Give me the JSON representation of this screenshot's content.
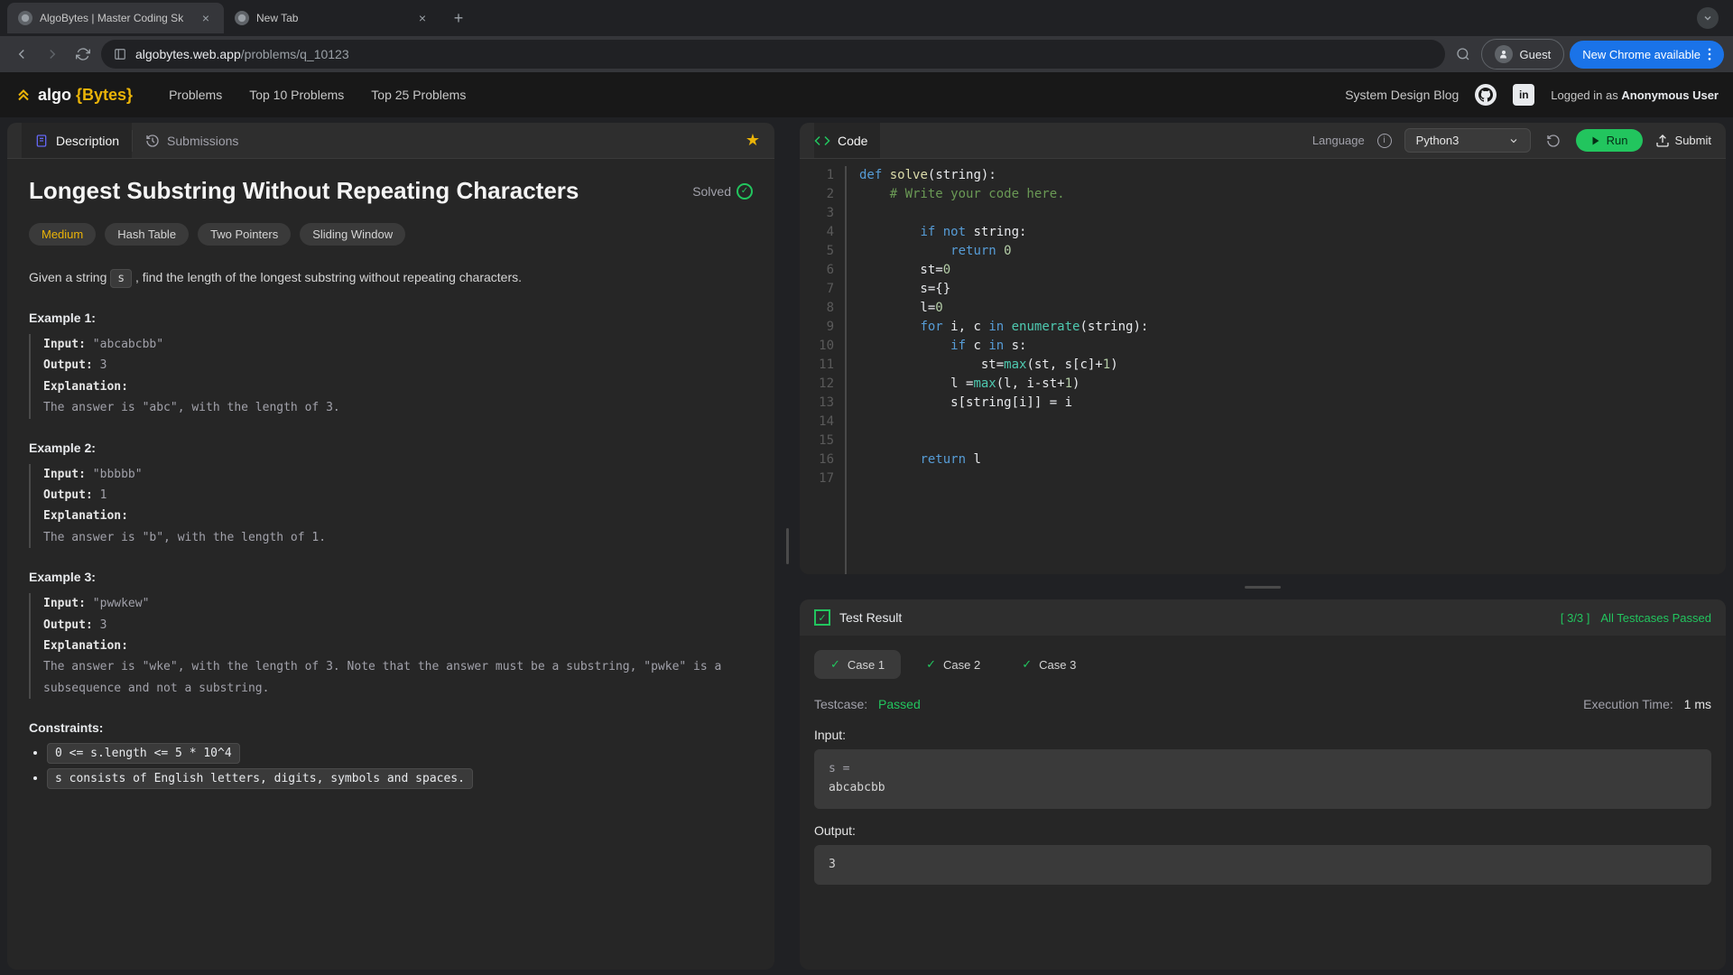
{
  "browser": {
    "tabs": [
      {
        "title": "AlgoBytes | Master Coding Sk",
        "active": true
      },
      {
        "title": "New Tab",
        "active": false
      }
    ],
    "url_domain": "algobytes.web.app",
    "url_path": "/problems/q_10123",
    "guest": "Guest",
    "new_chrome": "New Chrome available"
  },
  "header": {
    "logo_prefix": "algo",
    "logo_suffix": "{Bytes}",
    "nav": [
      "Problems",
      "Top 10 Problems",
      "Top 25 Problems"
    ],
    "right_link": "System Design Blog",
    "logged_in_prefix": "Logged in as ",
    "logged_in_user": "Anonymous User"
  },
  "left_panel": {
    "tabs": [
      "Description",
      "Submissions"
    ],
    "title": "Longest Substring Without Repeating Characters",
    "solved": "Solved",
    "tags": [
      "Medium",
      "Hash Table",
      "Two Pointers",
      "Sliding Window"
    ],
    "description_pre": "Given a string ",
    "description_var": "s",
    "description_post": " , find the length of the longest substring without repeating characters.",
    "examples": [
      {
        "title": "Example 1:",
        "input": "\"abcabcbb\"",
        "output": "3",
        "explanation": "The answer is \"abc\", with the length of 3."
      },
      {
        "title": "Example 2:",
        "input": "\"bbbbb\"",
        "output": "1",
        "explanation": "The answer is \"b\", with the length of 1."
      },
      {
        "title": "Example 3:",
        "input": "\"pwwkew\"",
        "output": "3",
        "explanation": "The answer is \"wke\", with the length of 3. Note that the answer must be a substring, \"pwke\" is a subsequence and not a substring."
      }
    ],
    "labels": {
      "input": "Input:",
      "output": "Output:",
      "explanation": "Explanation:"
    },
    "constraints_title": "Constraints:",
    "constraints": [
      "0 <= s.length <= 5 * 10^4",
      "s consists of English letters, digits, symbols and spaces."
    ]
  },
  "code_panel": {
    "title": "Code",
    "language_label": "Language",
    "language": "Python3",
    "run": "Run",
    "submit": "Submit",
    "lines": [
      {
        "n": 1,
        "html": "<span class='kw'>def</span> <span class='fn'>solve</span>(string):"
      },
      {
        "n": 2,
        "html": "    <span class='str'># Write your code here.</span>"
      },
      {
        "n": 3,
        "html": ""
      },
      {
        "n": 4,
        "html": "        <span class='kw'>if</span> <span class='kw'>not</span> string:"
      },
      {
        "n": 5,
        "html": "            <span class='kw'>return</span> <span class='num'>0</span>"
      },
      {
        "n": 6,
        "html": "        st=<span class='num'>0</span>"
      },
      {
        "n": 7,
        "html": "        s={}"
      },
      {
        "n": 8,
        "html": "        l=<span class='num'>0</span>"
      },
      {
        "n": 9,
        "html": "        <span class='kw'>for</span> i, c <span class='kw'>in</span> <span class='builtin'>enumerate</span>(string):"
      },
      {
        "n": 10,
        "html": "            <span class='kw'>if</span> c <span class='kw'>in</span> s:"
      },
      {
        "n": 11,
        "html": "                st=<span class='builtin'>max</span>(st, s[c]+<span class='num'>1</span>)"
      },
      {
        "n": 12,
        "html": "            l =<span class='builtin'>max</span>(l, i-st+<span class='num'>1</span>)"
      },
      {
        "n": 13,
        "html": "            s[string[i]] = i"
      },
      {
        "n": 14,
        "html": ""
      },
      {
        "n": 15,
        "html": ""
      },
      {
        "n": 16,
        "html": "        <span class='kw'>return</span> l"
      },
      {
        "n": 17,
        "html": ""
      }
    ]
  },
  "result_panel": {
    "title": "Test Result",
    "score": "[ 3/3 ]",
    "status": "All Testcases Passed",
    "cases": [
      "Case 1",
      "Case 2",
      "Case 3"
    ],
    "testcase_label": "Testcase:",
    "testcase_status": "Passed",
    "exec_label": "Execution Time:",
    "exec_value": "1 ms",
    "input_label": "Input:",
    "input_var": "s =",
    "input_value": "abcabcbb",
    "output_label": "Output:",
    "output_value": "3"
  }
}
